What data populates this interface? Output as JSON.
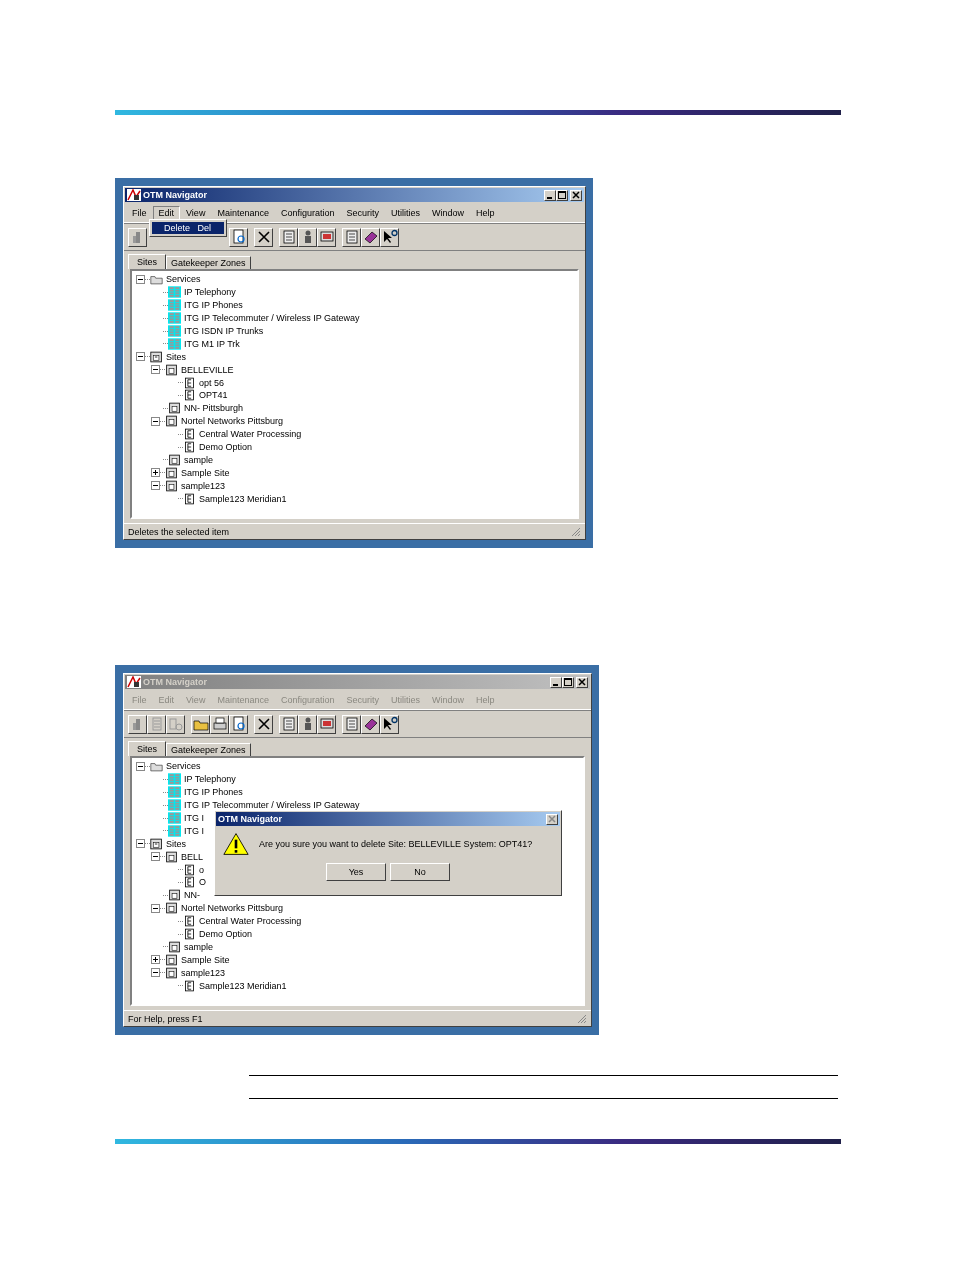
{
  "screenshots": [
    {
      "title": "OTM Navigator",
      "menu": [
        {
          "label": "File",
          "selected": false,
          "disabled": false
        },
        {
          "label": "Edit",
          "selected": true,
          "disabled": false
        },
        {
          "label": "View",
          "selected": false,
          "disabled": false
        },
        {
          "label": "Maintenance",
          "selected": false,
          "disabled": false
        },
        {
          "label": "Configuration",
          "selected": false,
          "disabled": false
        },
        {
          "label": "Security",
          "selected": false,
          "disabled": false
        },
        {
          "label": "Utilities",
          "selected": false,
          "disabled": false
        },
        {
          "label": "Window",
          "selected": false,
          "disabled": false
        },
        {
          "label": "Help",
          "selected": false,
          "disabled": false
        }
      ],
      "dropdown": [
        {
          "label": "Delete",
          "shortcut": "Del"
        }
      ],
      "tabs": [
        {
          "label": "Sites",
          "selected": true
        },
        {
          "label": "Gatekeeper Zones",
          "selected": false
        }
      ],
      "tree": [
        {
          "label": "Services",
          "kind": "folder",
          "expanded": true,
          "children": [
            {
              "label": "IP Telephony",
              "kind": "service"
            },
            {
              "label": "ITG IP Phones",
              "kind": "service"
            },
            {
              "label": "ITG IP Telecommuter / Wireless IP Gateway",
              "kind": "service"
            },
            {
              "label": "ITG ISDN IP Trunks",
              "kind": "service"
            },
            {
              "label": "ITG M1 IP Trk",
              "kind": "service"
            }
          ]
        },
        {
          "label": "Sites",
          "kind": "sites",
          "expanded": true,
          "children": [
            {
              "label": "BELLEVILLE",
              "kind": "site",
              "expanded": true,
              "children": [
                {
                  "label": "opt 56",
                  "kind": "system"
                },
                {
                  "label": "OPT41",
                  "kind": "system"
                }
              ]
            },
            {
              "label": "NN- Pittsburgh",
              "kind": "site"
            },
            {
              "label": "Nortel Networks Pittsburg",
              "kind": "site",
              "expanded": true,
              "children": [
                {
                  "label": "Central Water Processing",
                  "kind": "system"
                },
                {
                  "label": "Demo Option",
                  "kind": "system"
                }
              ]
            },
            {
              "label": "sample",
              "kind": "site"
            },
            {
              "label": "Sample Site",
              "kind": "site",
              "expanded": false
            },
            {
              "label": "sample123",
              "kind": "site",
              "expanded": true,
              "children": [
                {
                  "label": "Sample123 Meridian1",
                  "kind": "system"
                }
              ]
            }
          ]
        }
      ],
      "status": "Deletes the selected item"
    },
    {
      "title": "OTM Navigator",
      "menu": [
        {
          "label": "File",
          "selected": false,
          "disabled": true
        },
        {
          "label": "Edit",
          "selected": false,
          "disabled": true
        },
        {
          "label": "View",
          "selected": false,
          "disabled": true
        },
        {
          "label": "Maintenance",
          "selected": false,
          "disabled": true
        },
        {
          "label": "Configuration",
          "selected": false,
          "disabled": true
        },
        {
          "label": "Security",
          "selected": false,
          "disabled": true
        },
        {
          "label": "Utilities",
          "selected": false,
          "disabled": true
        },
        {
          "label": "Window",
          "selected": false,
          "disabled": true
        },
        {
          "label": "Help",
          "selected": false,
          "disabled": true
        }
      ],
      "tabs": [
        {
          "label": "Sites",
          "selected": true
        },
        {
          "label": "Gatekeeper Zones",
          "selected": false
        }
      ],
      "tree": [
        {
          "label": "Services",
          "kind": "folder",
          "expanded": true,
          "children": [
            {
              "label": "IP Telephony",
              "kind": "service"
            },
            {
              "label": "ITG IP Phones",
              "kind": "service"
            },
            {
              "label": "ITG IP Telecommuter / Wireless IP Gateway",
              "kind": "service"
            },
            {
              "label": "ITG I",
              "kind": "service"
            },
            {
              "label": "ITG I",
              "kind": "service"
            }
          ]
        },
        {
          "label": "Sites",
          "kind": "sites",
          "expanded": true,
          "children": [
            {
              "label": "BELL",
              "kind": "site",
              "expanded": true,
              "children": [
                {
                  "label": "o",
                  "kind": "system"
                },
                {
                  "label": "O",
                  "kind": "system"
                }
              ]
            },
            {
              "label": "NN-",
              "kind": "site"
            },
            {
              "label": "Nortel Networks Pittsburg",
              "kind": "site",
              "expanded": true,
              "children": [
                {
                  "label": "Central Water Processing",
                  "kind": "system"
                },
                {
                  "label": "Demo Option",
                  "kind": "system"
                }
              ]
            },
            {
              "label": "sample",
              "kind": "site"
            },
            {
              "label": "Sample Site",
              "kind": "site",
              "expanded": false
            },
            {
              "label": "sample123",
              "kind": "site",
              "expanded": true,
              "children": [
                {
                  "label": "Sample123 Meridian1",
                  "kind": "system"
                }
              ]
            }
          ]
        }
      ],
      "dialog": {
        "title": "OTM Navigator",
        "message": "Are you sure you want to delete Site: BELLEVILLE System: OPT41?",
        "buttons": [
          "Yes",
          "No"
        ]
      },
      "status": "For Help, press F1"
    }
  ]
}
